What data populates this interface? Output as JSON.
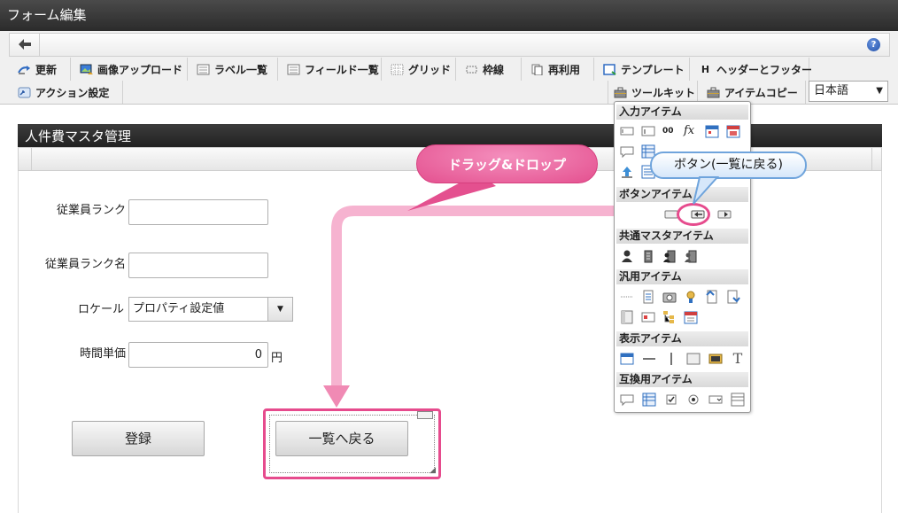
{
  "window": {
    "title": "フォーム編集"
  },
  "nav": {
    "back_icon": "left-arrow-icon",
    "help_symbol": "?"
  },
  "toolbar": {
    "row1": [
      {
        "id": "update",
        "label": "更新",
        "icon": "refresh-icon"
      },
      {
        "id": "image-upload",
        "label": "画像アップロード",
        "icon": "image-upload-icon"
      },
      {
        "id": "label-list",
        "label": "ラベル一覧",
        "icon": "list-icon"
      },
      {
        "id": "field-list",
        "label": "フィールド一覧",
        "icon": "list-icon"
      },
      {
        "id": "grid",
        "label": "グリッド",
        "icon": "grid-icon"
      },
      {
        "id": "border",
        "label": "枠線",
        "icon": "border-icon"
      },
      {
        "id": "reuse",
        "label": "再利用",
        "icon": "copy-icon"
      },
      {
        "id": "template",
        "label": "テンプレート",
        "icon": "template-icon"
      },
      {
        "id": "header-footer",
        "label": "ヘッダーとフッター",
        "icon": "header-icon",
        "glyph": "H"
      }
    ],
    "row2": [
      {
        "id": "action-settings",
        "label": "アクション設定",
        "icon": "action-icon"
      },
      {
        "id": "toolkit",
        "label": "ツールキット",
        "icon": "toolbox-icon"
      },
      {
        "id": "item-copy",
        "label": "アイテムコピー",
        "icon": "toolbox-icon"
      }
    ],
    "language": {
      "value": "日本語"
    }
  },
  "form": {
    "title": "人件費マスタ管理",
    "fields": [
      {
        "label": "従業員ランク",
        "value": ""
      },
      {
        "label": "従業員ランク名",
        "value": ""
      }
    ],
    "locale": {
      "label": "ロケール",
      "value": "プロパティ設定値"
    },
    "hourly_rate": {
      "label": "時間単価",
      "value": "0",
      "unit": "円"
    },
    "register_button": "登録",
    "back_to_list_button": "一覧へ戻る"
  },
  "toolkit_panel": {
    "sections": [
      {
        "title": "入力アイテム"
      },
      {
        "title": "ボタンアイテム"
      },
      {
        "title": "共通マスタアイテム"
      },
      {
        "title": "汎用アイテム"
      },
      {
        "title": "表示アイテム"
      },
      {
        "title": "互換用アイテム"
      }
    ],
    "fx_label": "fx",
    "num_label": "00"
  },
  "annotations": {
    "drag_badge": "ドラッグ&ドロップ",
    "tooltip": "ボタン(一覧に戻る)"
  },
  "colors": {
    "accent": "#e64b8d",
    "tooltip_border": "#6fa4dc",
    "titlebar": "#333333"
  }
}
